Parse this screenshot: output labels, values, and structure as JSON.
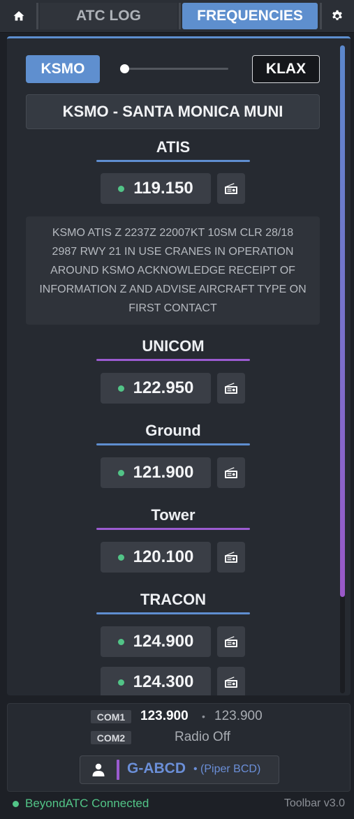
{
  "header": {
    "home_icon": "home-icon",
    "tabs": [
      {
        "label": "ATC LOG",
        "active": false
      },
      {
        "label": "FREQUENCIES",
        "active": true
      }
    ],
    "settings_icon": "gear-icon"
  },
  "route": {
    "from": "KSMO",
    "to": "KLAX",
    "selected": "KSMO",
    "airport_title": "KSMO - SANTA MONICA MUNI"
  },
  "sections": {
    "atis": {
      "heading": "ATIS",
      "freqs": [
        "119.150"
      ],
      "accent": "#5f8ed0",
      "text": "KSMO ATIS Z 2237Z 22007KT 10SM CLR 28/18 2987 RWY 21 IN USE CRANES IN OPERATION AROUND KSMO ACKNOWLEDGE RECEIPT OF INFORMATION Z AND ADVISE AIRCRAFT TYPE ON FIRST CONTACT"
    },
    "unicom": {
      "heading": "UNICOM",
      "freqs": [
        "122.950"
      ],
      "accent": "#9b5bd0"
    },
    "ground": {
      "heading": "Ground",
      "freqs": [
        "121.900"
      ],
      "accent": "#5f8ed0"
    },
    "tower": {
      "heading": "Tower",
      "freqs": [
        "120.100"
      ],
      "accent": "#9b5bd0"
    },
    "tracon": {
      "heading": "TRACON",
      "freqs": [
        "124.900",
        "124.300"
      ],
      "accent": "#5f8ed0"
    }
  },
  "radio_icon": "radio-icon",
  "com": {
    "com1": {
      "label": "COM1",
      "active": "123.900",
      "separator": "•",
      "standby": "123.900"
    },
    "com2": {
      "label": "COM2",
      "status": "Radio Off"
    }
  },
  "aircraft": {
    "icon": "person-icon",
    "callsign": "G-ABCD",
    "type": "• (Piper BCD)"
  },
  "footer": {
    "status": "BeyondATC Connected",
    "version": "Toolbar v3.0"
  },
  "colors": {
    "accent_blue": "#5f8fcf",
    "accent_purple": "#9b5bd0",
    "status_green": "#52c487",
    "background": "#1d2026",
    "panel": "#262a31"
  }
}
